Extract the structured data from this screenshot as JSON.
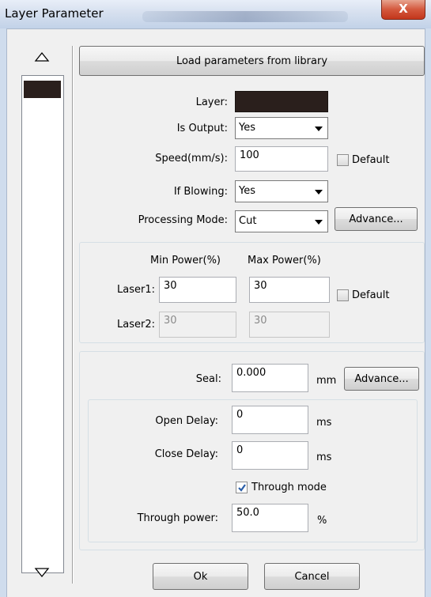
{
  "window": {
    "title": "Layer Parameter",
    "close_label": "X"
  },
  "toolbar": {
    "load_button": "Load parameters from library"
  },
  "layer": {
    "label": "Layer:",
    "color": "#2a1f1c"
  },
  "output": {
    "label": "Is Output:",
    "value": "Yes"
  },
  "speed": {
    "label": "Speed(mm/s):",
    "value": "100",
    "default_label": "Default",
    "default_checked": false
  },
  "blowing": {
    "label": "If Blowing:",
    "value": "Yes"
  },
  "processing": {
    "label": "Processing Mode:",
    "value": "Cut",
    "advance_label": "Advance..."
  },
  "power": {
    "min_header": "Min Power(%)",
    "max_header": "Max Power(%)",
    "laser1": {
      "label": "Laser1:",
      "min": "30",
      "max": "30"
    },
    "laser2": {
      "label": "Laser2:",
      "min": "30",
      "max": "30"
    },
    "default_label": "Default",
    "default_checked": false
  },
  "seal": {
    "label": "Seal:",
    "value": "0.000",
    "unit": "mm",
    "advance_label": "Advance..."
  },
  "delays": {
    "open_label": "Open Delay:",
    "open_value": "0",
    "open_unit": "ms",
    "close_label": "Close Delay:",
    "close_value": "0",
    "close_unit": "ms"
  },
  "through": {
    "mode_label": "Through mode",
    "mode_checked": true,
    "power_label": "Through power:",
    "power_value": "50.0",
    "power_unit": "%"
  },
  "footer": {
    "ok_label": "Ok",
    "cancel_label": "Cancel"
  },
  "colors": {
    "titlebar": "#d6e0ef",
    "close": "#c3361b",
    "layer_swatch": "#2a1f1c"
  }
}
